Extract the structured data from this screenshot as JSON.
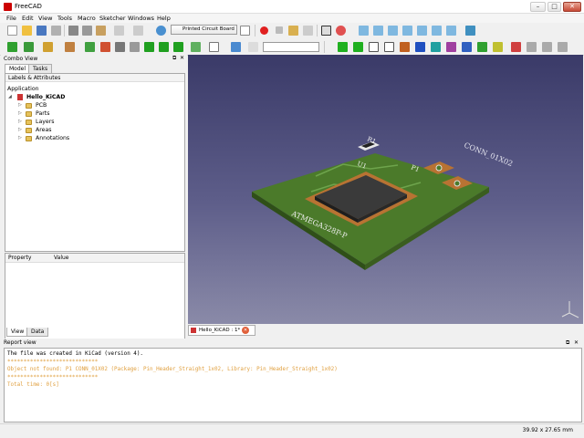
{
  "window": {
    "title": "FreeCAD",
    "min": "–",
    "max": "□",
    "close": "✕"
  },
  "menu": [
    "File",
    "Edit",
    "View",
    "Tools",
    "Macro",
    "Sketcher",
    "Windows",
    "Help"
  ],
  "toolbar": {
    "workbench": "Printed Circuit Board",
    "search_placeholder": ""
  },
  "colors": {
    "viewport_top": "#3a3a68",
    "viewport_bottom": "#8a8aa8",
    "board": "#4b7a2a",
    "board_edge": "#3a5d1f",
    "copper": "#b87333",
    "chip": "#3a3a3a",
    "log_warning": "#e0a040"
  },
  "combo": {
    "title": "Combo View",
    "tabs": [
      "Model",
      "Tasks"
    ],
    "tree_header": "Labels & Attributes",
    "root": "Application",
    "document": "Hello_KiCAD",
    "items": [
      "PCB",
      "Parts",
      "Layers",
      "Areas",
      "Annotations"
    ],
    "prop_columns": [
      "Property",
      "Value"
    ],
    "bottom_tabs": [
      "View",
      "Data"
    ]
  },
  "viewport": {
    "labels": {
      "conn": "CONN_01X02",
      "p1": "P1",
      "u1": "U1",
      "r1": "R1",
      "mcu": "ATMEGA328P-P"
    }
  },
  "doc_tab": {
    "label": "Hello_KiCAD : 1*"
  },
  "report": {
    "title": "Report view",
    "lines": [
      "The file was created in KiCad (version 4).",
      "****************************",
      "Object not found: P1 CONN_01X02 (Package: Pin_Header_Straight_1x02, Library: Pin_Header_Straight_1x02)",
      "****************************",
      "Total time: 0[s]"
    ]
  },
  "status": {
    "dimensions": "39.92 x 27.65 mm"
  }
}
